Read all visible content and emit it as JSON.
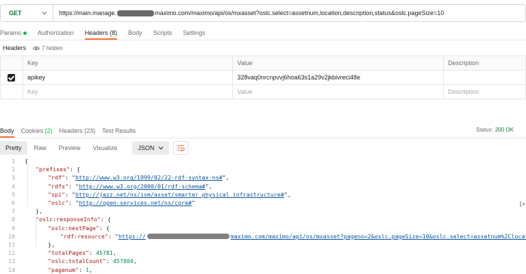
{
  "request": {
    "method": "GET",
    "url_prefix": "https://main.manage.",
    "url_suffix": "maximo.com/maximo/api/os/mxasset?oslc.select=assetnum,location,description,status&oslc.pageSize=10"
  },
  "request_tabs": [
    {
      "label": "Params"
    },
    {
      "label": "Authorization"
    },
    {
      "label": "Headers (8)"
    },
    {
      "label": "Body"
    },
    {
      "label": "Scripts"
    },
    {
      "label": "Settings"
    }
  ],
  "headers_section": {
    "title": "Headers",
    "hidden_label": "7 hidden"
  },
  "header_table": {
    "columns": [
      "Key",
      "Value",
      "Description"
    ],
    "rows": [
      {
        "key": "apikey",
        "value": "328vaq0nrcnpvvj6hoa63s1a29v2jkbivreci48e",
        "description": ""
      }
    ],
    "placeholder": {
      "key": "Key",
      "value": "Value",
      "description": "Description"
    }
  },
  "response_tabs": [
    {
      "label": "Body"
    },
    {
      "label": "Cookies",
      "count": "(2)"
    },
    {
      "label": "Headers (23)"
    },
    {
      "label": "Test Results"
    }
  ],
  "status": {
    "label": "Status:",
    "value": "200 OK"
  },
  "view_modes": [
    "Pretty",
    "Raw",
    "Preview",
    "Visualize"
  ],
  "format": "JSON",
  "code": {
    "line_numbers": [
      "1",
      "2",
      "3",
      "4",
      "5",
      "6",
      "7",
      "8",
      "9",
      "10",
      "11",
      "12",
      "13",
      "14"
    ],
    "l1": "{",
    "l2_key": "\"prefixes\"",
    "l3_key": "\"rdf\"",
    "l3_val": "http://www.w3.org/1999/02/22-rdf-syntax-ns#",
    "l4_key": "\"rdfs\"",
    "l4_val": "http://www.w3.org/2000/01/rdf-schema#",
    "l5_key": "\"spi\"",
    "l5_val": "http://jazz.net/ns/ism/asset/smarter_physical_infrastructure#",
    "l6_key": "\"oslc\"",
    "l6_val": "http://open-services.net/ns/core#",
    "l7": "},",
    "l8_key": "\"oslc:responseInfo\"",
    "l9_key": "\"oslc:nextPage\"",
    "l10_key": "\"rdf:resource\"",
    "l10_val_a": "https://",
    "l10_val_b": "maximo.com/maximo/api/os/mxasset?pageno=2&oslc.pageSize=10&oslc.select=assetnum%2Clocatio",
    "l11": "},",
    "l12_key": "\"totalPages\"",
    "l12_val": "45781",
    "l13_key": "\"oslc:totalCount\"",
    "l13_val": "457804",
    "l14_key": "\"pagenum\"",
    "l14_val": "1"
  }
}
